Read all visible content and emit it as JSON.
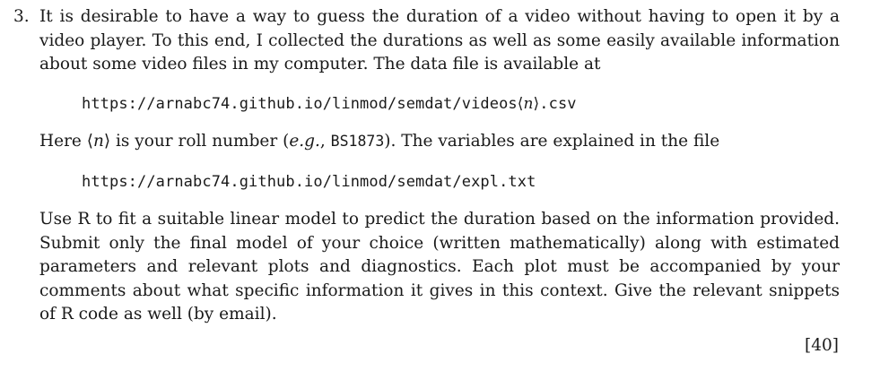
{
  "question": {
    "number": "3.",
    "paragraph1": "It is desirable to have a way to guess the duration of a video without having to open it by a video player. To this end, I collected the durations as well as some easily available information about some video files in my computer. The data file is available at",
    "url1": {
      "prefix": "https://arnabc74.github.io/linmod/semdat/videos",
      "langle": "⟨",
      "var": "n",
      "rangle": "⟩",
      "suffix": ".csv"
    },
    "paragraph2": {
      "start": "Here ",
      "langle": "⟨",
      "var": "n",
      "rangle": "⟩",
      "mid": " is your roll number (",
      "eg": "e.g.",
      "comma": ", ",
      "example": "BS1873",
      "end": "). The variables are explained in the file"
    },
    "url2": "https://arnabc74.github.io/linmod/semdat/expl.txt",
    "paragraph3": "Use R to fit a suitable linear model to predict the duration based on the information provided. Submit only the final model of your choice (written mathematically) along with estimated parameters and relevant plots and diagnostics. Each plot must be accompanied by your comments about what specific information it gives in this context. Give the relevant snippets of R code as well (by email).",
    "marks": "[40]"
  }
}
